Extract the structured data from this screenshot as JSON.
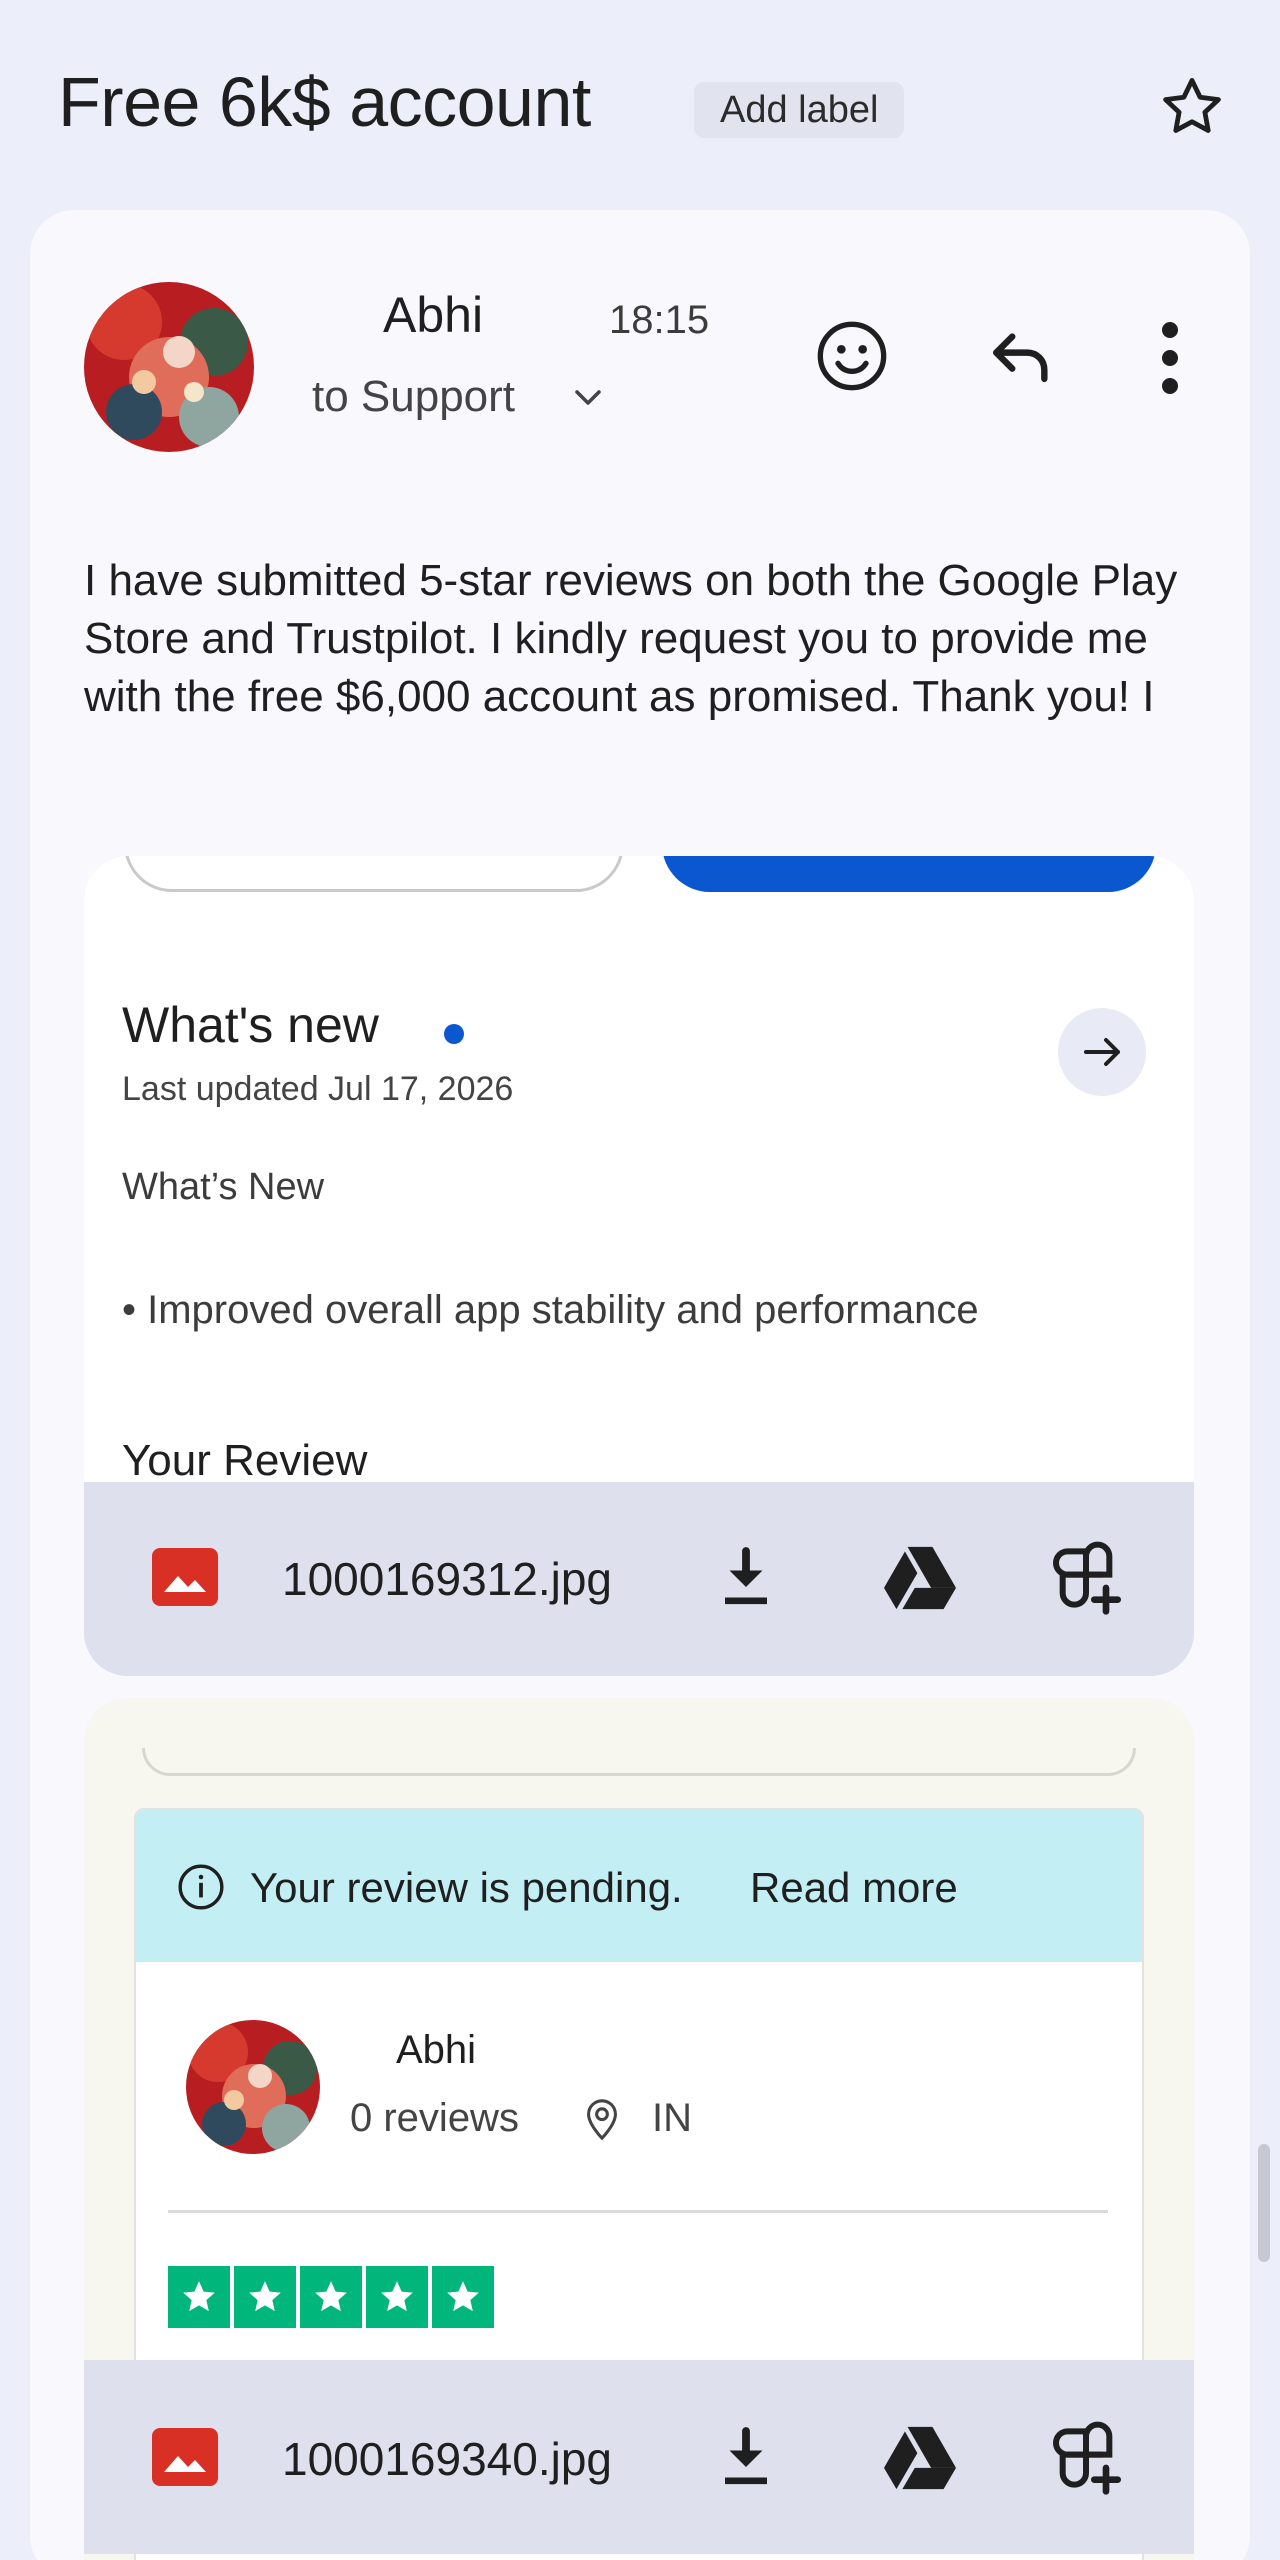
{
  "header": {
    "subject": "Free 6k$ account",
    "label_chip": "Add label",
    "star_icon": "star-outline-icon"
  },
  "message": {
    "sender": "Abhi",
    "time": "18:15",
    "recipient": "to Support",
    "body": "I have submitted 5-star reviews on both the Google Play Store and Trustpilot. I kindly request you to provide me with the free $6,000 account as promised. Thank you! I",
    "icons": [
      "emoji-icon",
      "reply-icon",
      "more-vert-icon"
    ]
  },
  "attachments": [
    {
      "filename": "1000169312.jpg",
      "screenshot": {
        "whats_new_title": "What's new",
        "last_updated": "Last updated Jul 17, 2026",
        "subheading": "What’s New",
        "bullet": "• Improved overall app stability and performance",
        "review_heading": "Your Review"
      }
    },
    {
      "filename": "1000169340.jpg",
      "screenshot": {
        "pending_text": "Your review is pending.",
        "read_more": "Read more",
        "reviewer_name": "Abhi",
        "review_count": "0 reviews",
        "country": "IN",
        "rating": 5
      }
    }
  ],
  "colors": {
    "background": "#eceef9",
    "card": "#f8f8fd",
    "attachment_bar": "#dfe0ed",
    "image_icon": "#d93025",
    "play_blue": "#0a57cf",
    "pending_banner": "#c3eef3",
    "trustpilot_green": "#00b67a"
  }
}
